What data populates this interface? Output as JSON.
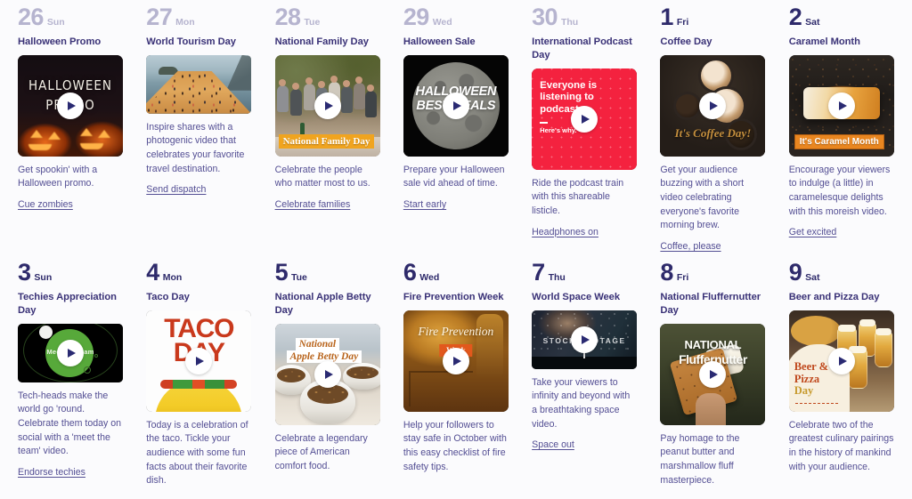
{
  "colors": {
    "navy": "#3a3277",
    "navy_deep": "#2e2a6b",
    "body_text": "#534e93",
    "muted_date": "#b6b4cf",
    "background": "#fbfbfd",
    "accent_orange": "#f0a41f",
    "accent_red": "#f4223f"
  },
  "calendar": {
    "weeks": [
      {
        "days": [
          {
            "date": "26",
            "dow": "Sun",
            "month": "prev",
            "event": {
              "title": "Halloween Promo",
              "thumb_shape": "square",
              "thumb_art": "halloween",
              "thumb_text": [
                "HALLOWEEN",
                "PROMO"
              ],
              "has_play": true,
              "desc": "Get spookin' with a Halloween promo.",
              "link": "Cue zombies"
            }
          },
          {
            "date": "27",
            "dow": "Mon",
            "month": "prev",
            "event": {
              "title": "World Tourism Day",
              "thumb_shape": "wide",
              "thumb_art": "tourism",
              "has_play": false,
              "desc": "Inspire shares with a photogenic video that celebrates your favorite travel destination.",
              "link": "Send dispatch"
            }
          },
          {
            "date": "28",
            "dow": "Tue",
            "month": "prev",
            "event": {
              "title": "National Family Day",
              "thumb_shape": "square",
              "thumb_art": "family",
              "badge": "National Family Day",
              "has_play": true,
              "desc": "Celebrate the people who matter most to us.",
              "link": "Celebrate families"
            }
          },
          {
            "date": "29",
            "dow": "Wed",
            "month": "prev",
            "event": {
              "title": "Halloween Sale",
              "thumb_shape": "square",
              "thumb_art": "halloween-sale",
              "thumb_text": [
                "HALLOWEEN",
                "BEST DEALS"
              ],
              "has_play": true,
              "desc": "Prepare your Halloween sale vid ahead of time.",
              "link": "Start early"
            }
          },
          {
            "date": "30",
            "dow": "Thu",
            "month": "prev",
            "event": {
              "title": "International Podcast Day",
              "thumb_shape": "square",
              "thumb_art": "podcast",
              "thumb_text": [
                "Everyone is listening to podcasts."
              ],
              "thumb_subtext": "Here's why.",
              "has_play": true,
              "desc": "Ride the podcast train with this shareable listicle.",
              "link": "Headphones on"
            }
          },
          {
            "date": "1",
            "dow": "Fri",
            "month": "current",
            "event": {
              "title": "Coffee Day",
              "thumb_shape": "square",
              "thumb_art": "coffee",
              "badge": "It's Coffee Day!",
              "has_play": true,
              "desc": "Get your audience buzzing with a short video celebrating everyone's favorite morning brew.",
              "link": "Coffee, please"
            }
          },
          {
            "date": "2",
            "dow": "Sat",
            "month": "current",
            "event": {
              "title": "Caramel Month",
              "thumb_shape": "square",
              "thumb_art": "caramel",
              "badge": "It's Caramel Month",
              "has_play": true,
              "desc": "Encourage your viewers to indulge (a little) in caramelesque delights with this moreish video.",
              "link": "Get excited"
            }
          }
        ]
      },
      {
        "days": [
          {
            "date": "3",
            "dow": "Sun",
            "month": "current",
            "event": {
              "title": "Techies Appreciation Day",
              "thumb_shape": "wide",
              "thumb_art": "techies",
              "thumb_text": [
                "Meet the team"
              ],
              "has_play": true,
              "desc": "Tech-heads make the world go 'round. Celebrate them today on social with a 'meet the team' video.",
              "link": "Endorse techies"
            }
          },
          {
            "date": "4",
            "dow": "Mon",
            "month": "current",
            "event": {
              "title": "Taco Day",
              "thumb_shape": "square",
              "thumb_art": "taco",
              "thumb_text": [
                "TACO",
                "DAY"
              ],
              "has_play": true,
              "desc": "Today is a celebration of the taco. Tickle your audience with some fun facts about their favorite dish.",
              "link": ""
            }
          },
          {
            "date": "5",
            "dow": "Tue",
            "month": "current",
            "event": {
              "title": "National Apple Betty Day",
              "thumb_shape": "square",
              "thumb_art": "apple-betty",
              "thumb_text": [
                "National",
                "Apple Betty Day"
              ],
              "has_play": true,
              "desc": "Celebrate a legendary piece of American comfort food.",
              "link": ""
            }
          },
          {
            "date": "6",
            "dow": "Wed",
            "month": "current",
            "event": {
              "title": "Fire Prevention Week",
              "thumb_shape": "square",
              "thumb_art": "fire",
              "thumb_text": [
                "Fire Prevention"
              ],
              "thumb_badge": "Week",
              "has_play": true,
              "desc": "Help your followers to stay safe in October with this easy checklist of fire safety tips.",
              "link": ""
            }
          },
          {
            "date": "7",
            "dow": "Thu",
            "month": "current",
            "event": {
              "title": "World Space Week",
              "thumb_shape": "wide",
              "thumb_art": "space",
              "thumb_text": [
                "STOCK FOOTAGE"
              ],
              "has_play": true,
              "desc": "Take your viewers to infinity and beyond with a breathtaking space video.",
              "link": "Space out"
            }
          },
          {
            "date": "8",
            "dow": "Fri",
            "month": "current",
            "event": {
              "title": "National Fluffernutter Day",
              "thumb_shape": "square",
              "thumb_art": "fluffernutter",
              "thumb_text": [
                "NATIONAL",
                "Fluffernutter"
              ],
              "has_play": true,
              "desc": "Pay homage to the peanut butter and marshmallow fluff masterpiece.",
              "link": ""
            }
          },
          {
            "date": "9",
            "dow": "Sat",
            "month": "current",
            "event": {
              "title": "Beer and Pizza Day",
              "thumb_shape": "square",
              "thumb_art": "beer-pizza",
              "thumb_text": [
                "Beer &",
                "Pizza",
                "Day"
              ],
              "has_play": true,
              "desc": "Celebrate two of the greatest culinary pairings in the history of mankind with your audience.",
              "link": ""
            }
          }
        ]
      }
    ]
  }
}
